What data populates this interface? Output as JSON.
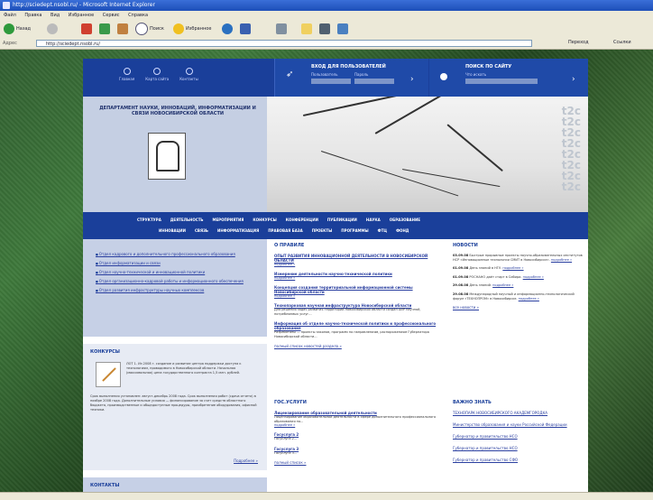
{
  "browser": {
    "title": "http://sciedept.nsobl.ru/ - Microsoft Internet Explorer",
    "menu": [
      "Файл",
      "Правка",
      "Вид",
      "Избранное",
      "Сервис",
      "Справка"
    ],
    "toolbar": {
      "back": "Назад",
      "search": "Поиск",
      "favorites": "Избранное"
    },
    "address_label": "Адрес",
    "address": "http://sciedept.nsobl.ru/",
    "go": "Переход",
    "links_label": "Ссылки"
  },
  "header": {
    "nav": [
      "Главная",
      "Карта сайта",
      "Контакты"
    ],
    "login_title": "ВХОД ДЛЯ ПОЛЬЗОВАТЕЛЕЙ",
    "login_user": "Пользователь",
    "login_pass": "Пароль",
    "search_title": "ПОИСК ПО САЙТУ",
    "search_label": "Что искать"
  },
  "banner": {
    "dept_name": "ДЕПАРТАМЕНТ НАУКИ, ИННОВАЦИЙ, ИНФОРМАТИЗАЦИИ И СВЯЗИ НОВОСИБИРСКОЙ ОБЛАСТИ",
    "decor": "t2c"
  },
  "topmenu": {
    "row1": [
      "СТРУКТУРА",
      "ДЕЯТЕЛЬНОСТЬ",
      "МЕРОПРИЯТИЯ",
      "КОНКУРСЫ",
      "КОНФЕРЕНЦИИ",
      "ПУБЛИКАЦИИ",
      "НАУКА",
      "ОБРАЗОВАНИЕ"
    ],
    "row2": [
      "ИННОВАЦИИ",
      "СВЯЗЬ",
      "ИНФОРМАТИЗАЦИЯ",
      "ПРАВОВАЯ БАЗА",
      "ПРОЕКТЫ",
      "ПРОГРАММЫ",
      "ФТЦ",
      "ФОНД"
    ]
  },
  "left": {
    "links": [
      "Отдел кадрового и дополнительного профессионального образования",
      "Отдел информатизации и связи",
      "Отдел научно-технической и инновационной политики",
      "Отдел организационно-кадровой работы и информационного обеспечения",
      "Отдел развития инфраструктуры научных комплексов"
    ],
    "contests_title": "КОНКУРСЫ",
    "contest_text": "ЛОТ 1. Из 2008 г. создание и развитие центра поддержки доступа к технологиям, проводимого в Новосибирской области. Начальная (максимальная) цена государственного контракта 1,5 млн. рублей.",
    "contest_text2": "Срок выполнения установлен: август-декабрь 2008 года. Срок выполнения работ (сдача отчета) в ноябре 2008 года. Дополнительные условия — финансирование за счет средств областного бюджета, производственные и общедоступные процедуры, приобретение оборудования, офисной техники.",
    "more": "Подробнее »",
    "contacts_title": "КОНТАКТЫ"
  },
  "mid": {
    "section_title": "О ПРАВИЛЕ",
    "items": [
      {
        "title": "ОПЫТ РАЗВИТИЯ ИННОВАЦИОННОЙ ДЕЯТЕЛЬНОСТИ В НОВОСИБИРСКОЙ ОБЛАСТИ",
        "desc": "",
        "more": "подробнее »"
      },
      {
        "title": "Измерение деятельности научно-технической политики",
        "desc": "",
        "more": "подробнее »"
      },
      {
        "title": "Концепция создания территориальной информационной системы Новосибирской области",
        "desc": "",
        "more": "подробнее »"
      },
      {
        "title": "Технопарковая научная инфраструктура Новосибирской области",
        "desc": "Для решения задач развития территорий Новосибирской области создан АИР научной, потребляемых услуг...",
        "more": ""
      },
      {
        "title": "Информация об отделе научно-технической политики и профессионального образования",
        "desc": "Разработаны — проекты законов, программ по направлениям, распоряжениям Губернатора Новосибирской области...",
        "more": ""
      }
    ],
    "all_news": "полный список новостей раздела »",
    "gos_title": "ГОС.УСЛУГИ",
    "gos_items": [
      {
        "title": "Лицензирование образовательной деятельности",
        "desc": "Лицензирование образовательной деятельности в сфере дополнительного профессионального образования по...",
        "more": "подробнее »"
      },
      {
        "title": "Госуслуга 2",
        "desc": "Госуслуга 2...",
        "more": ""
      },
      {
        "title": "Госуслуга 3",
        "desc": "Госуслуга 3...",
        "more": ""
      }
    ],
    "gos_all": "полный список »"
  },
  "right": {
    "news_title": "НОВОСТИ",
    "news": [
      {
        "date": "03.09.08",
        "text": "Быстрые прорывные проекты научно-образовательных институтов НСР «Инновационные технологии СМИТ в Новосибирске».",
        "more": "подробнее »"
      },
      {
        "date": "01.09.08",
        "text": "День знаний в НГУ.",
        "more": "подробнее »"
      },
      {
        "date": "01.09.08",
        "text": "РОСНАНО даёт старт в Сибири.",
        "more": "подробнее »"
      },
      {
        "date": "29.08.08",
        "text": "День знаний.",
        "more": "подробнее »"
      },
      {
        "date": "29.08.08",
        "text": "Международный научный и информационно-технологический форум «ТЕХНОПРОМ» в Новосибирске.",
        "more": "подробнее »"
      }
    ],
    "archive": "все новости »",
    "important_title": "ВАЖНО ЗНАТЬ",
    "important": [
      "ТЕХНОПАРК НОВОСИБИРСКОГО АКАДЕМГОРОДКА",
      "Министерство образования и науки Российской Федерации",
      "Губернатор и правительство НСО",
      "Губернатор и правительство НСО",
      "Губернатор и правительство СФО"
    ]
  }
}
